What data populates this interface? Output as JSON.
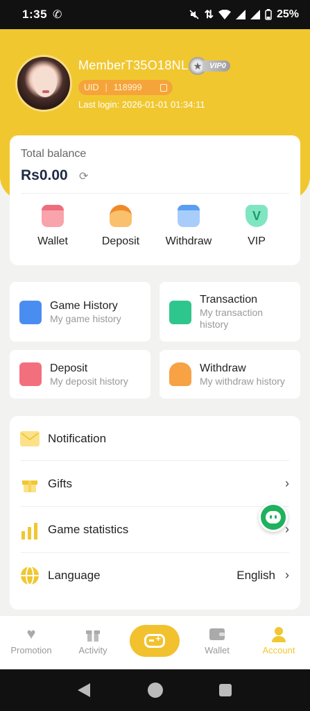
{
  "status_bar": {
    "time": "1:35",
    "battery": "25%"
  },
  "profile": {
    "username": "MemberT35O18NL",
    "vip_level": "VIP0",
    "uid_label": "UID",
    "uid_value": "118999",
    "last_login": "Last login: 2026-01-01 01:34:11"
  },
  "balance": {
    "label": "Total balance",
    "amount": "Rs0.00",
    "actions": [
      {
        "label": "Wallet",
        "icon": "wallet-icon",
        "color": "#f47a86"
      },
      {
        "label": "Deposit",
        "icon": "deposit-icon",
        "color": "#f79a36"
      },
      {
        "label": "Withdraw",
        "icon": "withdraw-icon",
        "color": "#5a9ef2"
      },
      {
        "label": "VIP",
        "icon": "vip-icon",
        "color": "#3fcf9c"
      }
    ]
  },
  "history_tiles": [
    {
      "title": "Game History",
      "subtitle": "My game history",
      "icon": "game-history-icon",
      "color": "#4a8df0"
    },
    {
      "title": "Transaction",
      "subtitle": "My transaction history",
      "icon": "transaction-icon",
      "color": "#2fc68e"
    },
    {
      "title": "Deposit",
      "subtitle": "My deposit history",
      "icon": "deposit-history-icon",
      "color": "#f2707d"
    },
    {
      "title": "Withdraw",
      "subtitle": "My withdraw history",
      "icon": "withdraw-history-icon",
      "color": "#f6a245"
    }
  ],
  "menu": {
    "notification": "Notification",
    "gifts": "Gifts",
    "game_statistics": "Game statistics",
    "language": "Language",
    "language_value": "English"
  },
  "bottom_nav": {
    "promotion": "Promotion",
    "activity": "Activity",
    "wallet": "Wallet",
    "account": "Account",
    "accent_color": "#f1c730"
  }
}
